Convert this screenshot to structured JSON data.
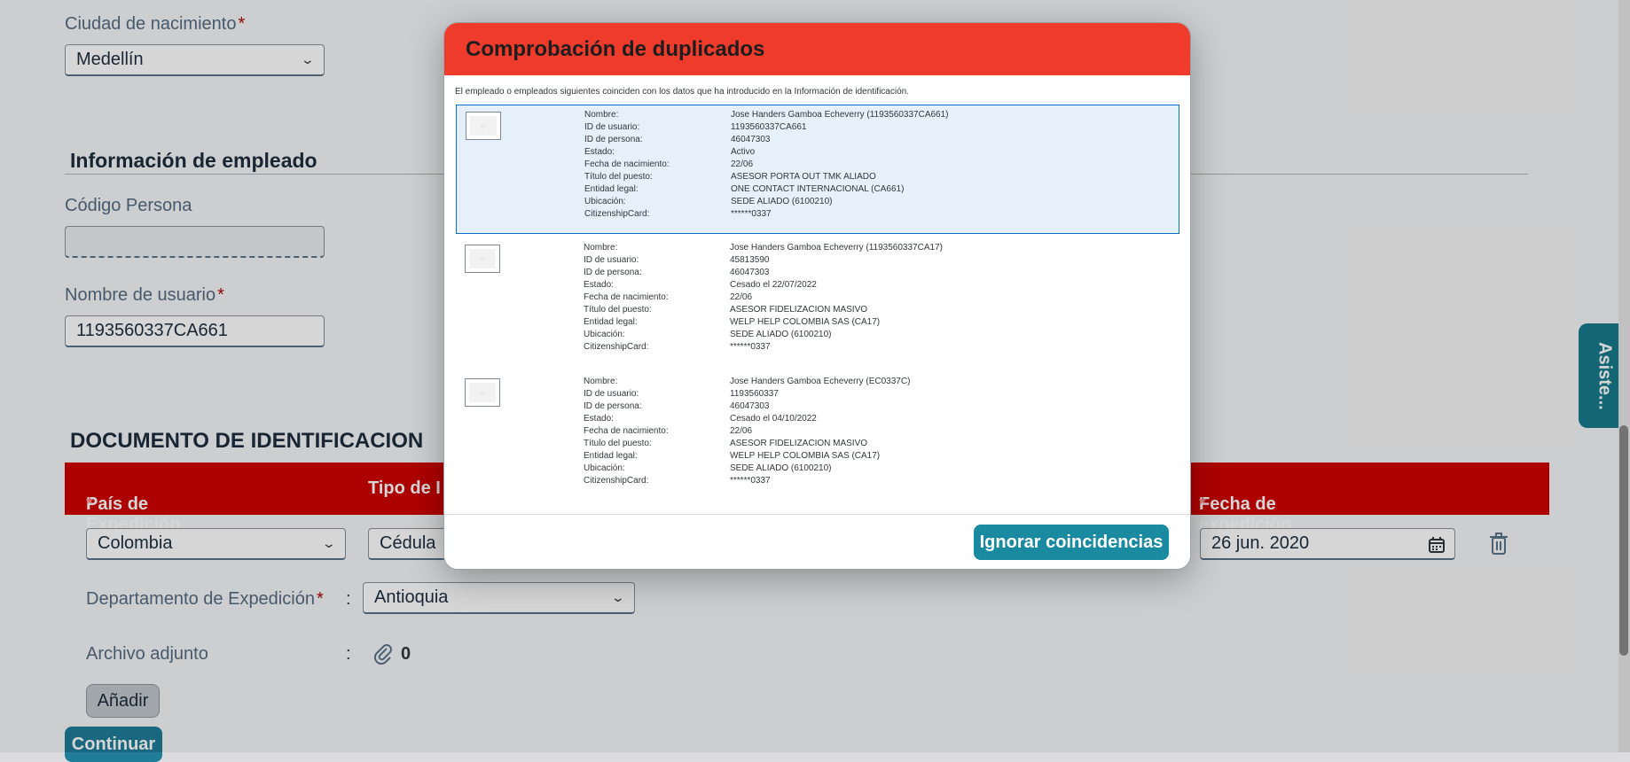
{
  "form": {
    "birth_city": {
      "label": "Ciudad de nacimiento",
      "required_mark": "*",
      "value": "Medellín"
    },
    "employee_section_title": "Información de empleado",
    "person_code": {
      "label": "Código Persona",
      "value": ""
    },
    "username": {
      "label": "Nombre de usuario",
      "required_mark": "*",
      "value": "1193560337CA661"
    },
    "id_doc_section_title": "DOCUMENTO DE IDENTIFICACION",
    "table_headers": {
      "country": "País de Expedición",
      "type": "Tipo de I",
      "issue_date": "Fecha de expedición",
      "required_mark": "*"
    },
    "country_value": "Colombia",
    "type_value": "Cédula",
    "issue_date_value": "26 jun. 2020",
    "department": {
      "label": "Departamento de Expedición",
      "required_mark": "*",
      "separator": ":",
      "value": "Antioquia"
    },
    "attachment": {
      "label": "Archivo adjunto",
      "separator": ":",
      "count": "0"
    },
    "add_button": "Añadir",
    "continue_button": "Continuar"
  },
  "side_tab": {
    "label": "Asiste..."
  },
  "dialog": {
    "title": "Comprobación de duplicados",
    "intro": "El empleado o empleados siguientes coinciden con los datos que ha introducido en la Información de identificación.",
    "field_labels": [
      "Nombre:",
      "ID de usuario:",
      "ID de persona:",
      "Estado:",
      "Fecha de nacimiento:",
      "Título del puesto:",
      "Entidad legal:",
      "Ubicación:",
      "CitizenshipCard:"
    ],
    "matches": [
      {
        "selected": true,
        "values": [
          "Jose Handers Gamboa Echeverry (1193560337CA661)",
          "1193560337CA661",
          "46047303",
          "Activo",
          "22/06",
          "ASESOR PORTA OUT TMK ALIADO",
          "ONE CONTACT INTERNACIONAL (CA661)",
          "SEDE ALIADO (6100210)",
          "******0337"
        ]
      },
      {
        "selected": false,
        "values": [
          "Jose Handers Gamboa Echeverry (1193560337CA17)",
          "45813590",
          "46047303",
          "Cesado el 22/07/2022",
          "22/06",
          "ASESOR FIDELIZACION MASIVO",
          "WELP HELP COLOMBIA SAS (CA17)",
          "SEDE ALIADO (6100210)",
          "******0337"
        ]
      },
      {
        "selected": false,
        "values": [
          "Jose Handers Gamboa Echeverry (EC0337C)",
          "1193560337",
          "46047303",
          "Cesado el 04/10/2022",
          "22/06",
          "ASESOR FIDELIZACION MASIVO",
          "WELP HELP COLOMBIA SAS (CA17)",
          "SEDE ALIADO (6100210)",
          "******0337"
        ]
      }
    ],
    "ignore_button": "Ignorar coincidencias"
  },
  "colors": {
    "header_red": "#ef3b2c",
    "table_red": "#cf0000",
    "teal": "#1a8aa0",
    "required": "#aa0808"
  }
}
